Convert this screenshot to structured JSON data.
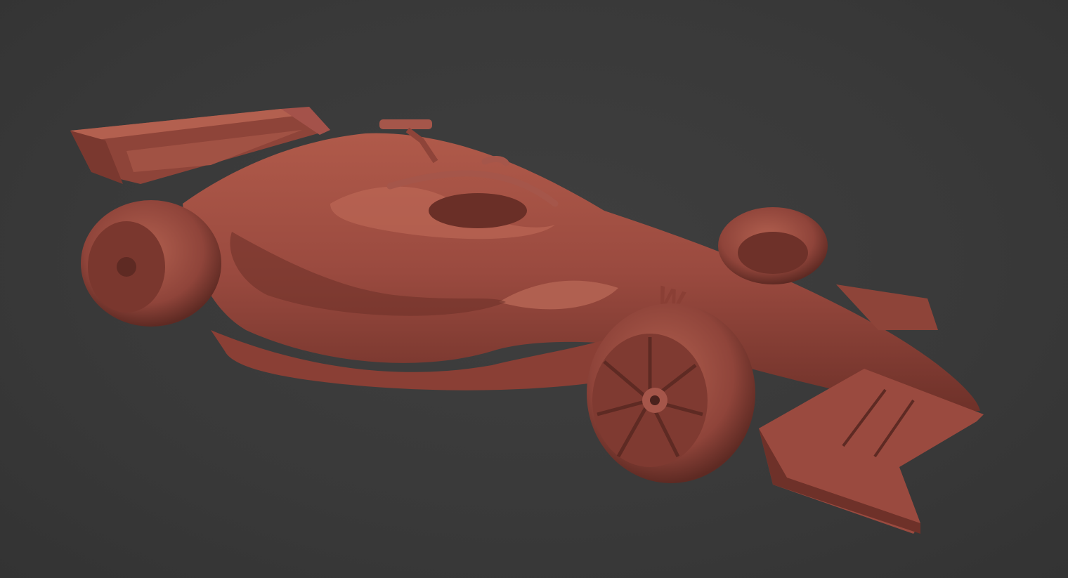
{
  "scene": {
    "subject": "car-model",
    "logo_text": "W",
    "colors": {
      "background": "#3b3b3b",
      "body": "#9a4a3f",
      "body_light": "#b5604f",
      "body_dark": "#6e3129",
      "shadow": "#4a221d"
    }
  }
}
